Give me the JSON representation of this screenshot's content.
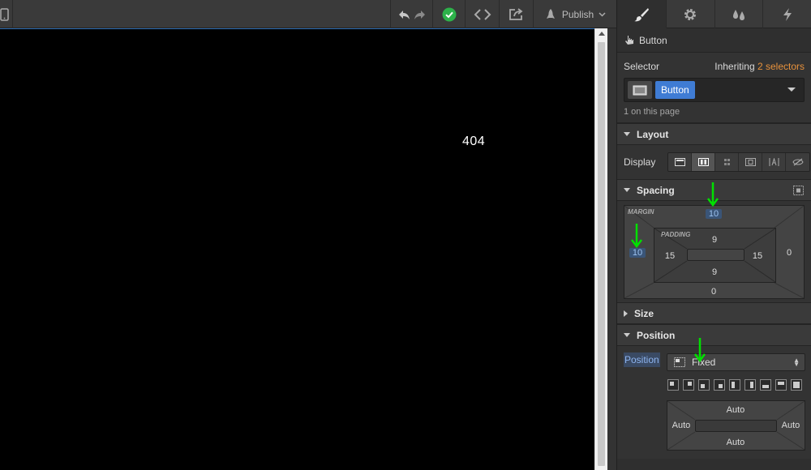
{
  "toolbar": {
    "publish_label": "Publish"
  },
  "canvas": {
    "text": "404"
  },
  "panel": {
    "element": {
      "name": "Button"
    },
    "selector": {
      "label": "Selector",
      "inheriting_prefix": "Inheriting",
      "inheriting_count": "2 selectors",
      "chip": "Button",
      "on_page": "1 on this page"
    },
    "layout": {
      "title": "Layout",
      "display_label": "Display"
    },
    "spacing": {
      "title": "Spacing",
      "margin_label": "MARGIN",
      "padding_label": "PADDING",
      "margin": {
        "top": "10",
        "right": "0",
        "bottom": "0",
        "left": "10"
      },
      "padding": {
        "top": "9",
        "right": "15",
        "bottom": "9",
        "left": "15"
      }
    },
    "size": {
      "title": "Size"
    },
    "position": {
      "title": "Position",
      "label": "Position",
      "value": "Fixed",
      "offsets": {
        "top": "Auto",
        "right": "Auto",
        "bottom": "Auto",
        "left": "Auto"
      }
    }
  },
  "colors": {
    "accent_blue": "#3f7cd4",
    "orange": "#e8923c",
    "publish_check": "#2db24a",
    "annotation_arrow": "#00e000"
  }
}
